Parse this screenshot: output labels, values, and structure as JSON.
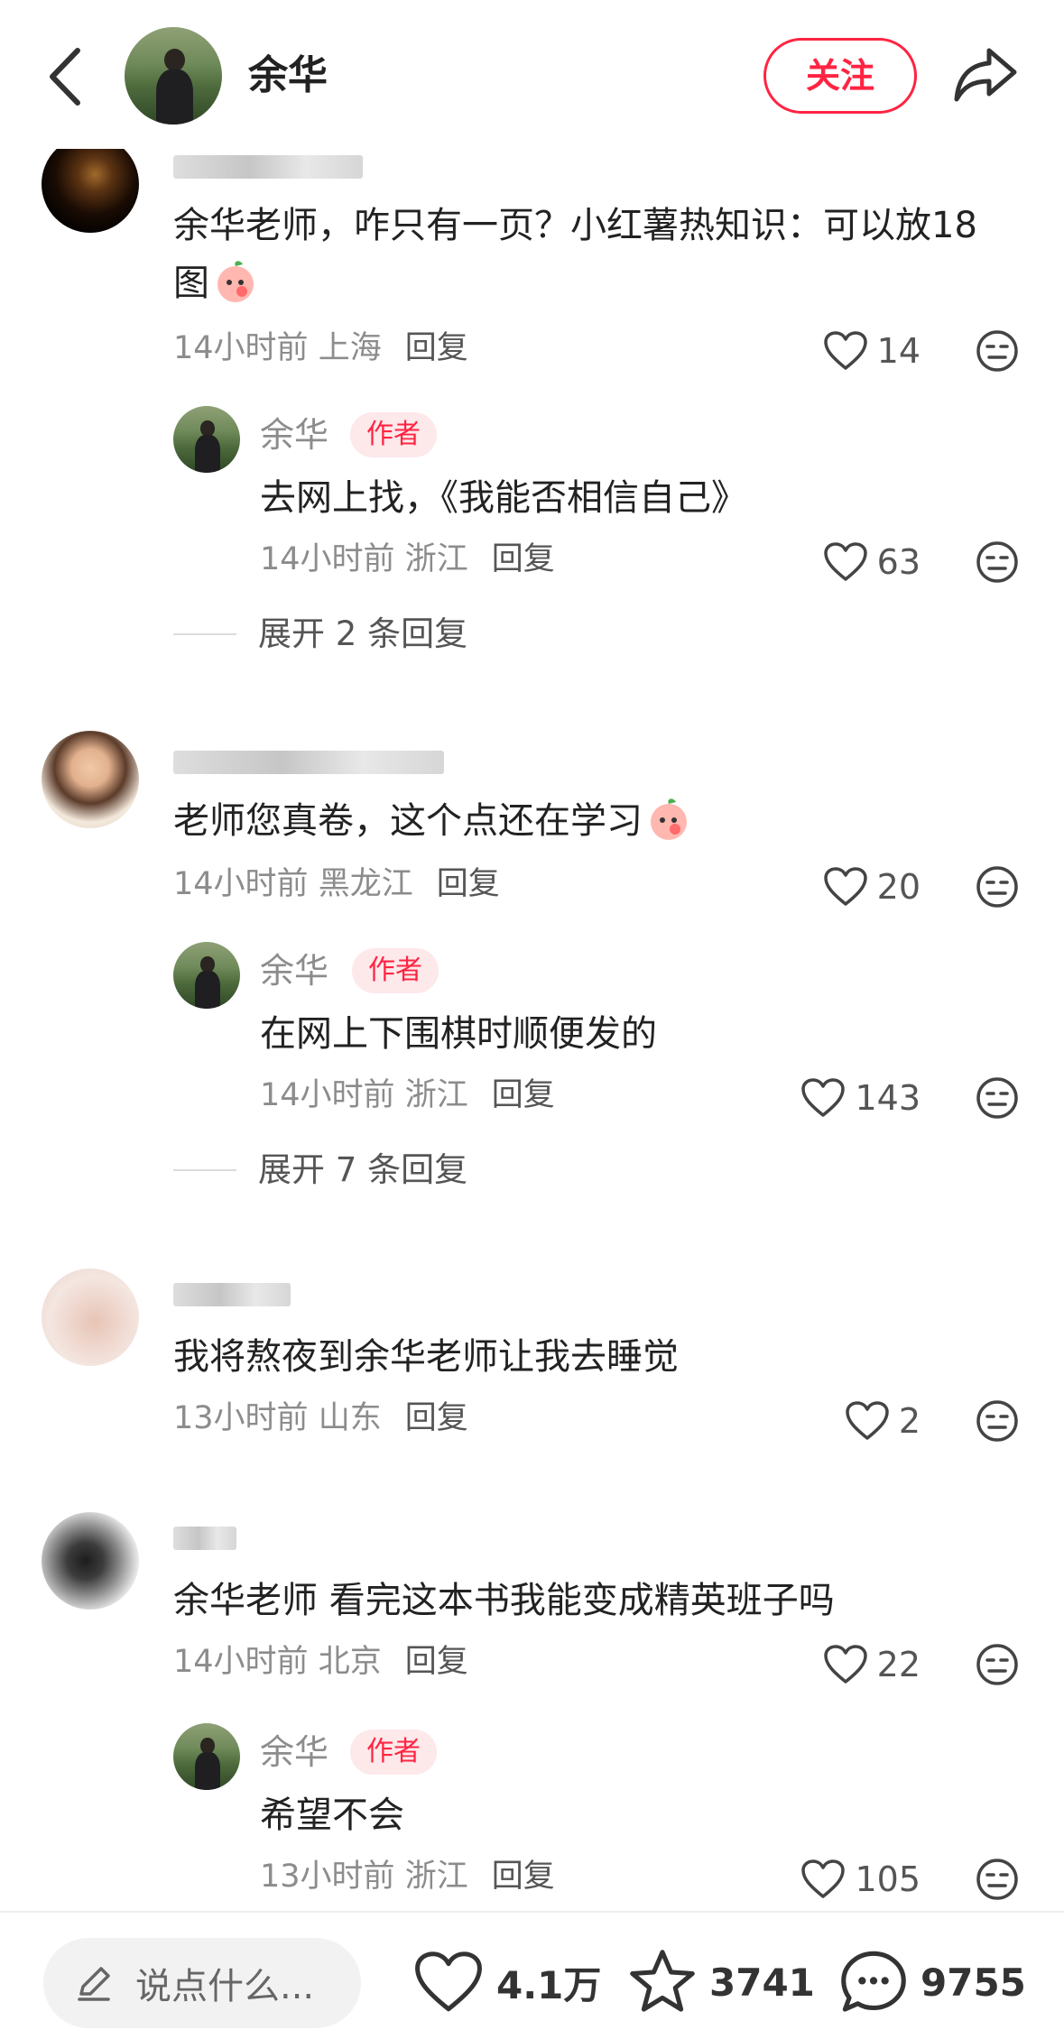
{
  "header": {
    "author_name": "余华",
    "follow_label": "关注",
    "icons": {
      "back": "back-chevron-icon",
      "share": "share-arrow-icon"
    }
  },
  "comments": [
    {
      "text": "余华老师，咋只有一页？小红薯热知识：可以放18图",
      "emoji": "peach-face-emoji",
      "time": "14小时前",
      "location": "上海",
      "reply_label": "回复",
      "likes": "14",
      "author_reply": {
        "name": "余华",
        "badge": "作者",
        "text": "去网上找，《我能否相信自己》",
        "time": "14小时前",
        "location": "浙江",
        "reply_label": "回复",
        "likes": "63"
      },
      "expand_label": "展开 2 条回复"
    },
    {
      "text": "老师您真卷，这个点还在学习",
      "emoji": "peach-face-emoji",
      "time": "14小时前",
      "location": "黑龙江",
      "reply_label": "回复",
      "likes": "20",
      "author_reply": {
        "name": "余华",
        "badge": "作者",
        "text": "在网上下围棋时顺便发的",
        "time": "14小时前",
        "location": "浙江",
        "reply_label": "回复",
        "likes": "143"
      },
      "expand_label": "展开 7 条回复"
    },
    {
      "text": "我将熬夜到余华老师让我去睡觉",
      "time": "13小时前",
      "location": "山东",
      "reply_label": "回复",
      "likes": "2"
    },
    {
      "text": "余华老师 看完这本书我能变成精英班子吗",
      "time": "14小时前",
      "location": "北京",
      "reply_label": "回复",
      "likes": "22",
      "author_reply": {
        "name": "余华",
        "badge": "作者",
        "text": "希望不会",
        "time": "13小时前",
        "location": "浙江",
        "reply_label": "回复",
        "likes": "105"
      }
    }
  ],
  "bottom_bar": {
    "input_placeholder": "说点什么...",
    "likes": "4.1万",
    "collects": "3741",
    "comments": "9755"
  },
  "colors": {
    "accent": "#ff2442",
    "badge_bg": "#fde8ea",
    "meta_text": "#8c8c8c"
  }
}
